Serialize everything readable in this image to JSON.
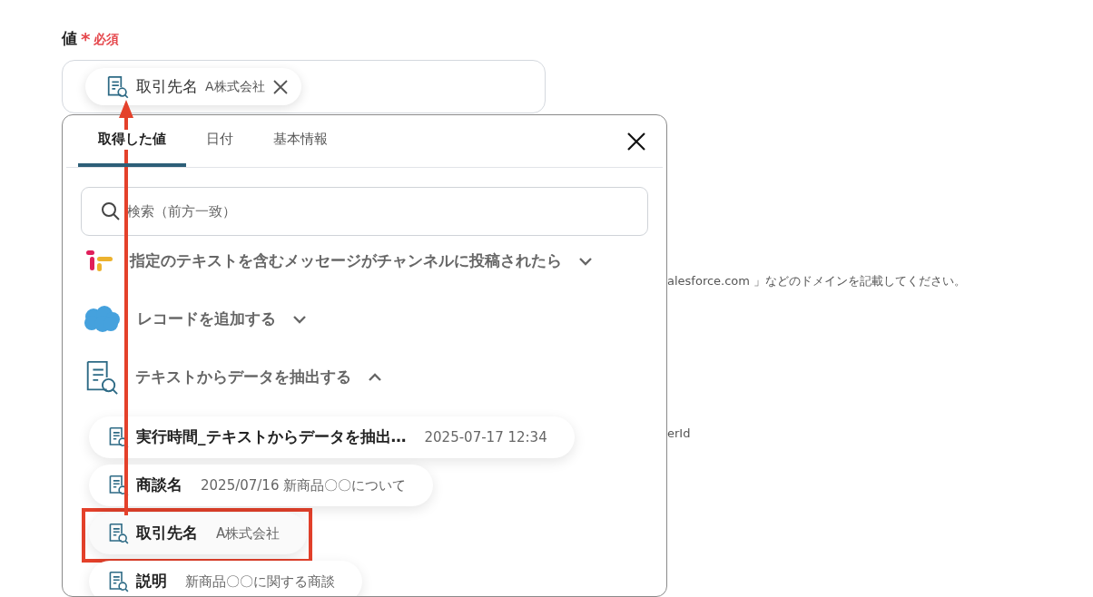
{
  "field": {
    "label": "値",
    "required_mark": "*",
    "required_text": "必須",
    "chip": {
      "name": "取引先名",
      "value": "A株式会社"
    }
  },
  "popup": {
    "tabs": [
      {
        "label": "取得した値",
        "selected": true
      },
      {
        "label": "日付",
        "selected": false
      },
      {
        "label": "基本情報",
        "selected": false
      }
    ],
    "search": {
      "placeholder": "検索（前方一致）"
    },
    "groups": [
      {
        "kind": "slack",
        "title": "指定のテキストを含むメッセージがチャンネルに投稿されたら",
        "expanded": false
      },
      {
        "kind": "salesforce",
        "title": "レコードを追加する",
        "expanded": false
      },
      {
        "kind": "extract",
        "title": "テキストからデータを抽出する",
        "expanded": true,
        "items": [
          {
            "name": "実行時間_テキストからデータを抽出…",
            "value": "2025-07-17 12:34",
            "highlighted": false
          },
          {
            "name": "商談名",
            "value": "2025/07/16 新商品〇〇について",
            "highlighted": false
          },
          {
            "name": "取引先名",
            "value": "A株式会社",
            "highlighted": true
          },
          {
            "name": "説明",
            "value": "新商品〇〇に関する商談",
            "highlighted": false
          }
        ]
      }
    ]
  },
  "background_texts": [
    "alesforce.com 」などのドメインを記載してください。",
    "erId"
  ]
}
